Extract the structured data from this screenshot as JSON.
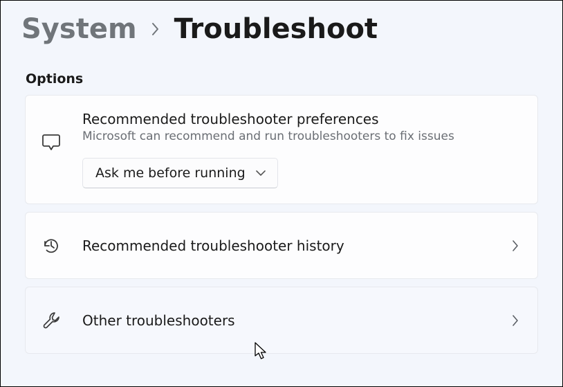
{
  "breadcrumb": {
    "parent": "System",
    "current": "Troubleshoot"
  },
  "section": {
    "title": "Options"
  },
  "preferences": {
    "title": "Recommended troubleshooter preferences",
    "subtitle": "Microsoft can recommend and run troubleshooters to fix issues",
    "dropdown_value": "Ask me before running"
  },
  "rows": {
    "history": {
      "label": "Recommended troubleshooter history"
    },
    "other": {
      "label": "Other troubleshooters"
    }
  }
}
